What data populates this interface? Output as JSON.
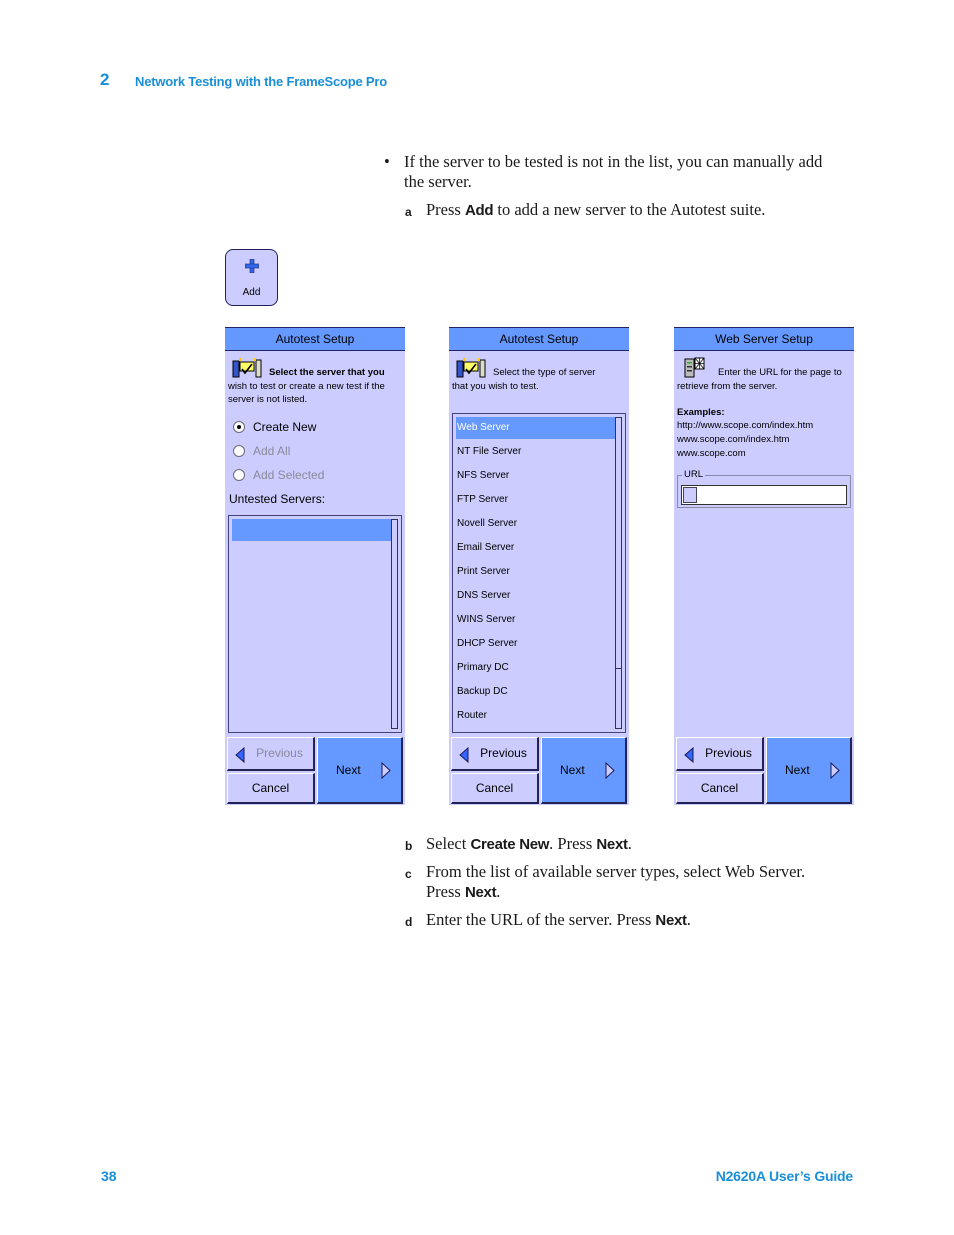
{
  "header": {
    "chapter_number": "2",
    "chapter_title": "Network Testing with the FrameScope Pro"
  },
  "body": {
    "bullet_char": "•",
    "bullet_text": "If the server to be tested is not in the list, you can manually add the server.",
    "step_a": {
      "letter": "a",
      "pre": "Press ",
      "bold": "Add",
      "post": " to add a new server to the Autotest suite."
    },
    "step_b": {
      "letter": "b",
      "pre": "Select ",
      "bold1": "Create New",
      "mid": ". Press ",
      "bold2": "Next",
      "post": "."
    },
    "step_c": {
      "letter": "c",
      "pre": "From the list of available server types, select Web Server. Press ",
      "bold": "Next",
      "post": "."
    },
    "step_d": {
      "letter": "d",
      "pre": "Enter the URL of the server. Press ",
      "bold": "Next",
      "post": "."
    }
  },
  "add_button": {
    "label": "Add",
    "icon": "plus-icon"
  },
  "panels": [
    {
      "title": "Autotest Setup",
      "icon": "autotest-icon",
      "intro_line1": "Select the server that you",
      "intro_rest": "wish to test or create a new test if the server is not listed.",
      "radios": [
        {
          "label": "Create New",
          "checked": true,
          "enabled": true
        },
        {
          "label": "Add All",
          "checked": false,
          "enabled": false
        },
        {
          "label": "Add Selected",
          "checked": false,
          "enabled": false
        }
      ],
      "list_label": "Untested Servers:",
      "buttons": {
        "previous": "Previous",
        "next": "Next",
        "cancel": "Cancel",
        "previous_enabled": false
      }
    },
    {
      "title": "Autotest Setup",
      "icon": "autotest-icon",
      "intro_line1": "Select the type of server",
      "intro_rest": "that you wish to test.",
      "server_types": [
        "Web Server",
        "NT File Server",
        "NFS Server",
        "FTP Server",
        "Novell Server",
        "Email Server",
        "Print Server",
        "DNS Server",
        "WINS Server",
        "DHCP Server",
        "Primary DC",
        "Backup DC",
        "Router"
      ],
      "selected_index": 0,
      "buttons": {
        "previous": "Previous",
        "next": "Next",
        "cancel": "Cancel",
        "previous_enabled": true
      }
    },
    {
      "title": "Web Server Setup",
      "icon": "web-server-icon",
      "intro_line1": "Enter the URL for the page to",
      "intro_rest": "retrieve from the server.",
      "examples_label": "Examples:",
      "examples": [
        "http://www.scope.com/index.htm",
        "www.scope.com/index.htm",
        "www.scope.com"
      ],
      "url_label": "URL",
      "url_value": "",
      "buttons": {
        "previous": "Previous",
        "next": "Next",
        "cancel": "Cancel",
        "previous_enabled": true
      }
    }
  ],
  "footer": {
    "page_number": "38",
    "guide_title": "N2620A User’s Guide"
  },
  "colors": {
    "accent_blue": "#1a8fd8",
    "panel_bg": "#ccccff",
    "title_bar": "#6699ff"
  }
}
